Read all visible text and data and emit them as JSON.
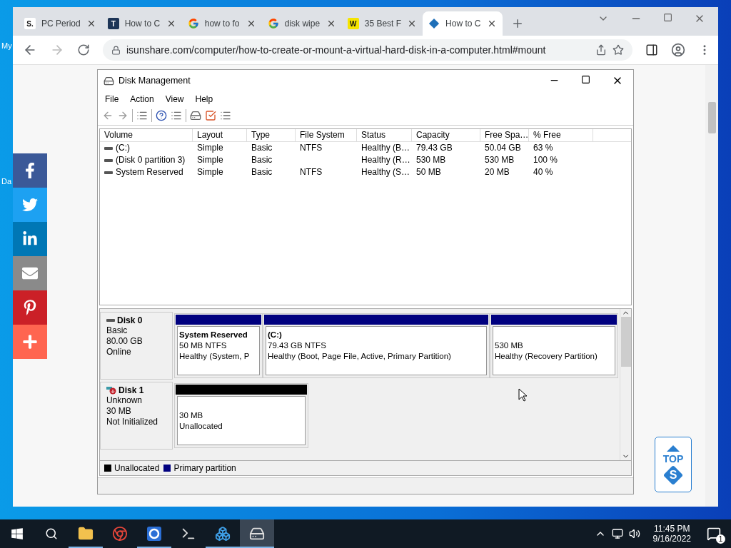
{
  "desktop_labels": [
    "My",
    "Da"
  ],
  "browser": {
    "tabs": [
      {
        "kind": "letter",
        "favicon_text": "S.",
        "title": "PC Period",
        "selected": false
      },
      {
        "kind": "dark-letter",
        "favicon_text": "T",
        "title": "How to C",
        "selected": false
      },
      {
        "kind": "google",
        "title": "how to fo",
        "selected": false
      },
      {
        "kind": "google",
        "title": "disk wipe",
        "selected": false
      },
      {
        "kind": "yellow-letter",
        "favicon_text": "W",
        "title": "35 Best F",
        "selected": false
      },
      {
        "kind": "diamond",
        "title": "How to C",
        "selected": true
      }
    ],
    "url": "isunshare.com/computer/how-to-create-or-mount-a-virtual-hard-disk-in-a-computer.html#mount"
  },
  "social": [
    {
      "kind": "facebook"
    },
    {
      "kind": "twitter"
    },
    {
      "kind": "linkedin"
    },
    {
      "kind": "email"
    },
    {
      "kind": "pinterest"
    },
    {
      "kind": "more"
    }
  ],
  "top_button": {
    "label": "TOP",
    "logo_text": "S"
  },
  "disk_management": {
    "title": "Disk Management",
    "menu": [
      "File",
      "Action",
      "View",
      "Help"
    ],
    "columns": [
      "Volume",
      "Layout",
      "Type",
      "File System",
      "Status",
      "Capacity",
      "Free Spa…",
      "% Free"
    ],
    "rows": [
      [
        "(C:)",
        "Simple",
        "Basic",
        "NTFS",
        "Healthy (B…",
        "79.43 GB",
        "50.04 GB",
        "63 %"
      ],
      [
        "(Disk 0 partition 3)",
        "Simple",
        "Basic",
        "",
        "Healthy (R…",
        "530 MB",
        "530 MB",
        "100 %"
      ],
      [
        "System Reserved",
        "Simple",
        "Basic",
        "NTFS",
        "Healthy (S…",
        "50 MB",
        "20 MB",
        "40 %"
      ]
    ],
    "disks": [
      {
        "name": "Disk 0",
        "kind": "online",
        "type": "Basic",
        "size": "80.00 GB",
        "status": "Online",
        "partitions": [
          {
            "kind": "primary",
            "name": "System Reserved",
            "size": "50 MB NTFS",
            "status": "Healthy (System, P"
          },
          {
            "kind": "primary",
            "name": "(C:)",
            "size": "79.43 GB NTFS",
            "status": "Healthy (Boot, Page File, Active, Primary Partition)"
          },
          {
            "kind": "primary",
            "size": "530 MB",
            "status": "Healthy (Recovery Partition)"
          }
        ]
      },
      {
        "name": "Disk 1",
        "kind": "not-initialized",
        "type": "Unknown",
        "size": "30 MB",
        "status": "Not Initialized",
        "partitions": [
          {
            "kind": "unallocated",
            "size": "30 MB",
            "status": "Unallocated"
          }
        ]
      }
    ],
    "legend": [
      {
        "kind": "unallocated",
        "label": "Unallocated"
      },
      {
        "kind": "primary",
        "label": "Primary partition"
      }
    ]
  },
  "taskbar": {
    "apps": [
      {
        "kind": "folder",
        "running": true,
        "selected": false
      },
      {
        "kind": "chrome",
        "running": false,
        "selected": false
      },
      {
        "kind": "ring",
        "running": true,
        "selected": false
      },
      {
        "kind": "terminal",
        "running": false,
        "selected": false
      },
      {
        "kind": "cubes",
        "running": true,
        "selected": false
      },
      {
        "kind": "disk",
        "running": true,
        "selected": true
      }
    ],
    "time": "11:45 PM",
    "date": "9/16/2022",
    "notifications": "1"
  }
}
